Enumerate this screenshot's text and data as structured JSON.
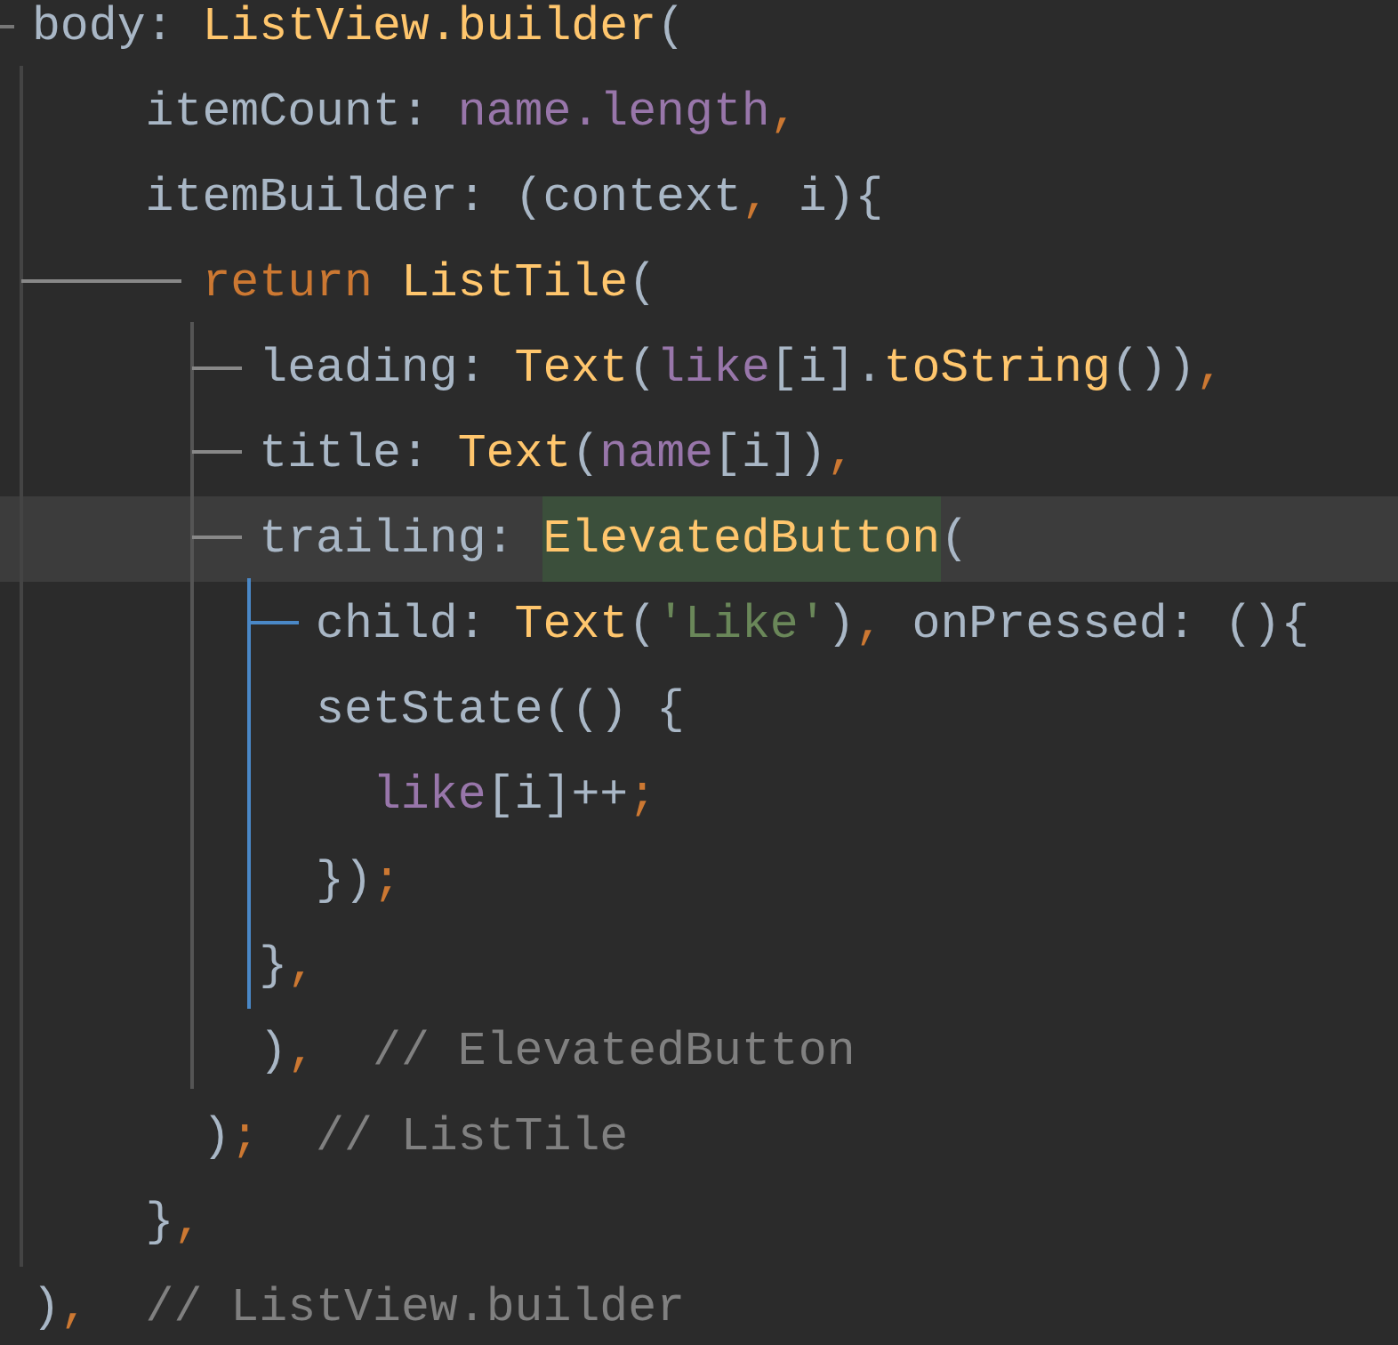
{
  "editor": {
    "lines": [
      {
        "current": false,
        "tokens": [
          {
            "text": " body: ",
            "kind": "plain"
          },
          {
            "text": "ListView.builder",
            "kind": "func"
          },
          {
            "text": "(",
            "kind": "plain"
          }
        ]
      },
      {
        "current": false,
        "tokens": [
          {
            "text": "     itemCount: ",
            "kind": "plain"
          },
          {
            "text": "name.length",
            "kind": "field"
          },
          {
            "text": ",",
            "kind": "punct"
          }
        ]
      },
      {
        "current": false,
        "tokens": [
          {
            "text": "     itemBuilder: (context",
            "kind": "plain"
          },
          {
            "text": ",",
            "kind": "punct"
          },
          {
            "text": " i){",
            "kind": "plain"
          }
        ]
      },
      {
        "current": false,
        "tokens": [
          {
            "text": "       return ",
            "kind": "keyword"
          },
          {
            "text": "ListTile",
            "kind": "func"
          },
          {
            "text": "(",
            "kind": "plain"
          }
        ]
      },
      {
        "current": false,
        "tokens": [
          {
            "text": "         leading: ",
            "kind": "plain"
          },
          {
            "text": "Text",
            "kind": "func"
          },
          {
            "text": "(",
            "kind": "plain"
          },
          {
            "text": "like",
            "kind": "field"
          },
          {
            "text": "[i].",
            "kind": "plain"
          },
          {
            "text": "toString",
            "kind": "func"
          },
          {
            "text": "())",
            "kind": "plain"
          },
          {
            "text": ",",
            "kind": "punct"
          }
        ]
      },
      {
        "current": false,
        "tokens": [
          {
            "text": "         title: ",
            "kind": "plain"
          },
          {
            "text": "Text",
            "kind": "func"
          },
          {
            "text": "(",
            "kind": "plain"
          },
          {
            "text": "name",
            "kind": "field"
          },
          {
            "text": "[i])",
            "kind": "plain"
          },
          {
            "text": ",",
            "kind": "punct"
          }
        ]
      },
      {
        "current": true,
        "tokens": [
          {
            "text": "         trailing: ",
            "kind": "plain"
          },
          {
            "text": "ElevatedButton",
            "kind": "func",
            "highlighted": true
          },
          {
            "text": "(",
            "kind": "plain"
          }
        ]
      },
      {
        "current": false,
        "tokens": [
          {
            "text": "           child: ",
            "kind": "plain"
          },
          {
            "text": "Text",
            "kind": "func"
          },
          {
            "text": "(",
            "kind": "plain"
          },
          {
            "text": "'Like'",
            "kind": "string"
          },
          {
            "text": ")",
            "kind": "plain"
          },
          {
            "text": ",",
            "kind": "punct"
          },
          {
            "text": " onPressed: (){",
            "kind": "plain"
          }
        ]
      },
      {
        "current": false,
        "tokens": [
          {
            "text": "           setState(() {",
            "kind": "plain"
          }
        ]
      },
      {
        "current": false,
        "tokens": [
          {
            "text": "             like",
            "kind": "field"
          },
          {
            "text": "[i]++",
            "kind": "plain"
          },
          {
            "text": ";",
            "kind": "punct"
          }
        ]
      },
      {
        "current": false,
        "tokens": [
          {
            "text": "           })",
            "kind": "plain"
          },
          {
            "text": ";",
            "kind": "punct"
          }
        ]
      },
      {
        "current": false,
        "tokens": [
          {
            "text": "         }",
            "kind": "plain"
          },
          {
            "text": ",",
            "kind": "punct"
          }
        ]
      },
      {
        "current": false,
        "tokens": [
          {
            "text": "         )",
            "kind": "plain"
          },
          {
            "text": ",",
            "kind": "punct"
          },
          {
            "text": "  // ElevatedButton",
            "kind": "comment"
          }
        ]
      },
      {
        "current": false,
        "tokens": [
          {
            "text": "       )",
            "kind": "plain"
          },
          {
            "text": ";",
            "kind": "punct"
          },
          {
            "text": "  // ListTile",
            "kind": "comment"
          }
        ]
      },
      {
        "current": false,
        "tokens": [
          {
            "text": "     }",
            "kind": "plain"
          },
          {
            "text": ",",
            "kind": "punct"
          }
        ]
      },
      {
        "current": false,
        "tokens": [
          {
            "text": " )",
            "kind": "plain"
          },
          {
            "text": ",",
            "kind": "punct"
          },
          {
            "text": "  // ListView.builder",
            "kind": "comment"
          }
        ]
      }
    ]
  }
}
